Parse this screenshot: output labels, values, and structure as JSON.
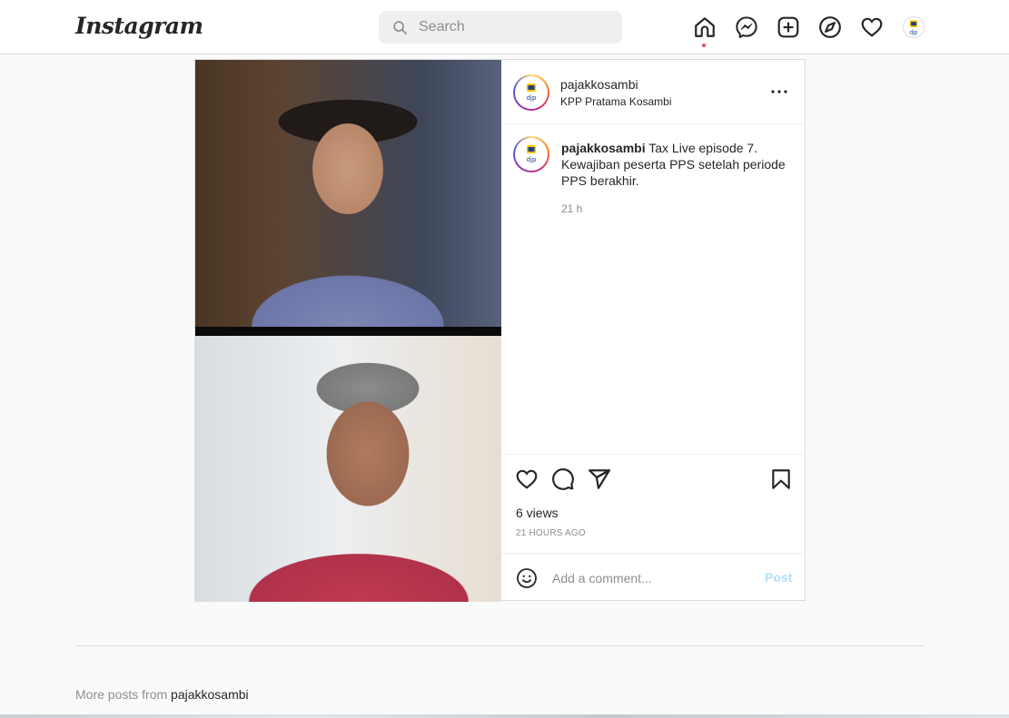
{
  "header": {
    "logo_text": "Instagram",
    "search": {
      "placeholder": "Search",
      "value": ""
    },
    "nav_icons": [
      "home-icon",
      "messenger-icon",
      "new-post-icon",
      "explore-icon",
      "activity-heart-icon",
      "profile-avatar"
    ]
  },
  "post": {
    "author": {
      "username": "pajakkosambi",
      "location": "KPP Pratama Kosambi"
    },
    "caption": {
      "username": "pajakkosambi",
      "text": "Tax Live episode 7. Kewajiban peserta PPS setelah periode PPS berakhir.",
      "time": "21 h"
    },
    "views": "6 views",
    "posted_ago": "21 HOURS AGO",
    "comment": {
      "placeholder": "Add a comment...",
      "value": "",
      "post_label": "Post"
    },
    "action_icons": [
      "like-heart-icon",
      "comment-icon",
      "share-icon",
      "save-bookmark-icon"
    ]
  },
  "more_posts": {
    "prefix": "More posts from",
    "username": "pajakkosambi"
  },
  "colors": {
    "accent_blue_disabled": "#b2dffc",
    "notification_dot": "#ed4956",
    "border": "#dbdbdb",
    "secondary_text": "#8e8e8e"
  }
}
